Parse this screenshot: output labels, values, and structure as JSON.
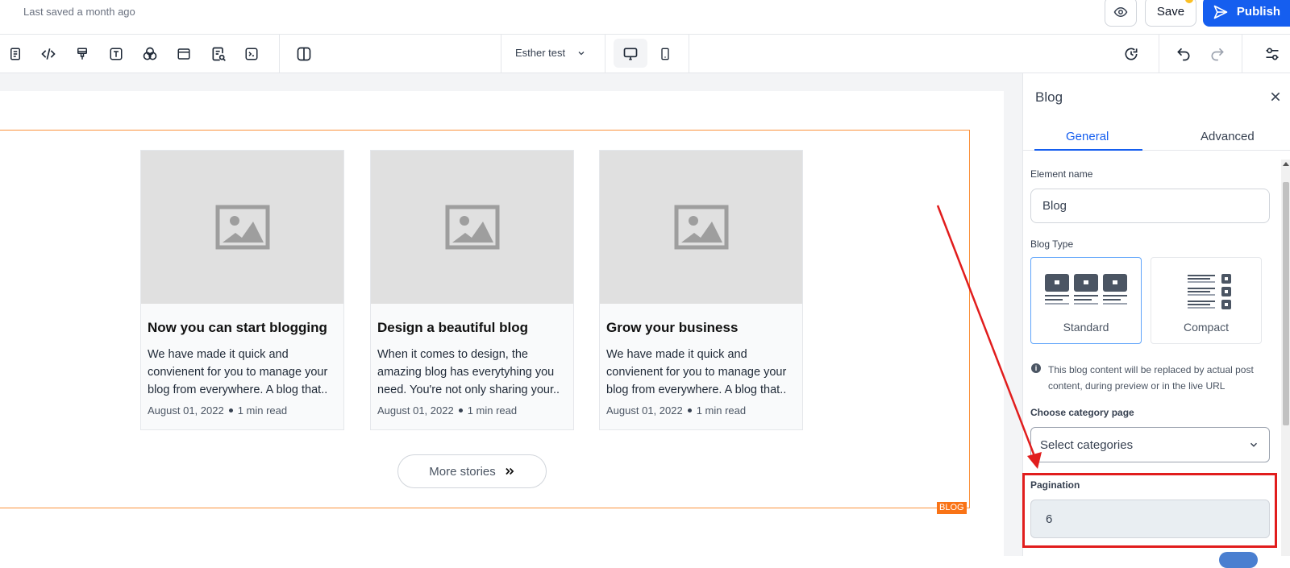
{
  "header": {
    "last_saved": "Last saved a month ago",
    "save_label": "Save",
    "publish_label": "Publish"
  },
  "toolbar": {
    "page_name": "Esther test"
  },
  "blog": {
    "badge": "BLOG",
    "cards": [
      {
        "title": "Now you can start blogging",
        "excerpt_lines": [
          "We have made it quick and",
          "convienent for you to manage your",
          "blog from everywhere. A blog that.."
        ],
        "date": "August 01, 2022",
        "read_time": "1 min read"
      },
      {
        "title": "Design a beautiful blog",
        "excerpt_lines": [
          "When it comes to design, the",
          "amazing blog has everytyhing you",
          "need. You're not only sharing your.."
        ],
        "date": "August 01, 2022",
        "read_time": "1 min read"
      },
      {
        "title": "Grow your business",
        "excerpt_lines": [
          "We have made it quick and",
          "convienent for you to manage your",
          "blog from everywhere. A blog that.."
        ],
        "date": "August 01, 2022",
        "read_time": "1 min read"
      }
    ],
    "more_label": "More stories"
  },
  "panel": {
    "title": "Blog",
    "tabs": [
      {
        "label": "General",
        "active": true
      },
      {
        "label": "Advanced",
        "active": false
      }
    ],
    "element_name_label": "Element name",
    "element_name_value": "Blog",
    "blog_type_label": "Blog Type",
    "blog_types": [
      {
        "label": "Standard",
        "selected": true
      },
      {
        "label": "Compact",
        "selected": false
      }
    ],
    "info_text": "This blog content will be replaced by actual post content, during preview or in the live URL",
    "category_label": "Choose category page",
    "category_placeholder": "Select categories",
    "pagination_label": "Pagination",
    "pagination_value": "6"
  },
  "colors": {
    "accent": "#155eef",
    "annotation": "#e11d1d",
    "blog_frame": "#fb923c",
    "badge": "#f97316"
  }
}
